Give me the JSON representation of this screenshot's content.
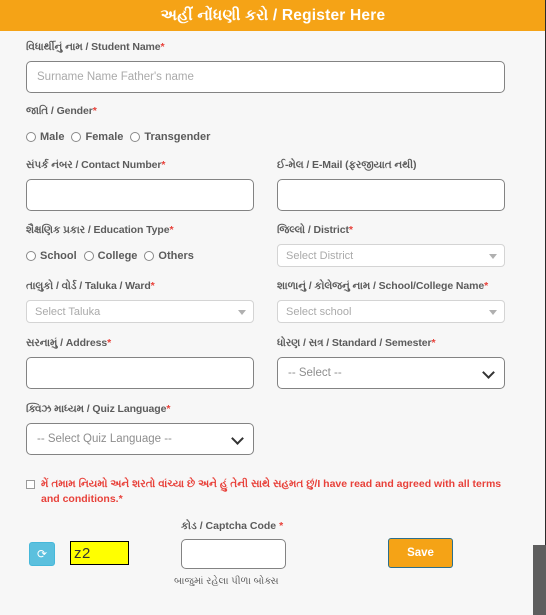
{
  "header": {
    "title": "અહીં નોંધણી કરો / Register Here"
  },
  "fields": {
    "student_name": {
      "label_gu": "વિધાર્થીનું નામ",
      "label": "વિધાર્થીનું નામ / Student Name",
      "required_mark": "*",
      "placeholder": "Surname Name Father's name",
      "value": ""
    },
    "gender": {
      "label": "જાતિ / Gender",
      "required_mark": "*",
      "options": [
        "Male",
        "Female",
        "Transgender"
      ],
      "selected": ""
    },
    "contact_number": {
      "label": "સંપર્ક નંબર / Contact Number",
      "required_mark": "*",
      "placeholder": "",
      "value": ""
    },
    "email": {
      "label": "ઈ-મેલ / E-Mail (ફરજીયાત નથી)",
      "required_mark": "",
      "placeholder": "",
      "value": ""
    },
    "education_type": {
      "label": "શૈક્ષણિક પ્રકાર / Education Type",
      "required_mark": "*",
      "options": [
        "School",
        "College",
        "Others"
      ],
      "selected": ""
    },
    "district": {
      "label": "જિલ્લો / District",
      "required_mark": "*",
      "placeholder": "Select District",
      "value": ""
    },
    "taluka": {
      "label": "તાલુકો / વોર્ડ / Taluka / Ward",
      "required_mark": "*",
      "placeholder": "Select Taluka",
      "value": ""
    },
    "school_name": {
      "label": "શાળાનું / કોલેજનું નામ / School/College Name",
      "required_mark": "*",
      "placeholder": "Select school",
      "value": ""
    },
    "address": {
      "label": "સરનામું / Address",
      "required_mark": "*",
      "placeholder": "",
      "value": ""
    },
    "standard": {
      "label": "ધોરણ / સત્ર / Standard / Semester",
      "required_mark": "*",
      "selected": "-- Select --"
    },
    "quiz_language": {
      "label": "ક્વિઝ માધ્યમ / Quiz Language",
      "required_mark": "*",
      "selected": "-- Select Quiz Language --"
    },
    "captcha_code": {
      "label": "કોડ / Captcha Code",
      "required_mark": "*",
      "value": "",
      "display_value": "z2",
      "hint": "બાજુમાં રહેલા પીળા બોક્સ"
    }
  },
  "terms": {
    "text": "મેં તમામ નિયમો અને શરતો વાંચ્યા છે અને હું તેની સાથે સહમત છું/I have read and agreed with all terms and conditions.*",
    "checked": false
  },
  "buttons": {
    "save_label": "Save",
    "refresh_icon": "⟳"
  },
  "colors": {
    "header_bg": "#F5A316",
    "accent_orange": "#F5A316",
    "required_red": "#e8413a",
    "captcha_yellow": "#ffff00",
    "refresh_blue": "#5bc0de"
  }
}
